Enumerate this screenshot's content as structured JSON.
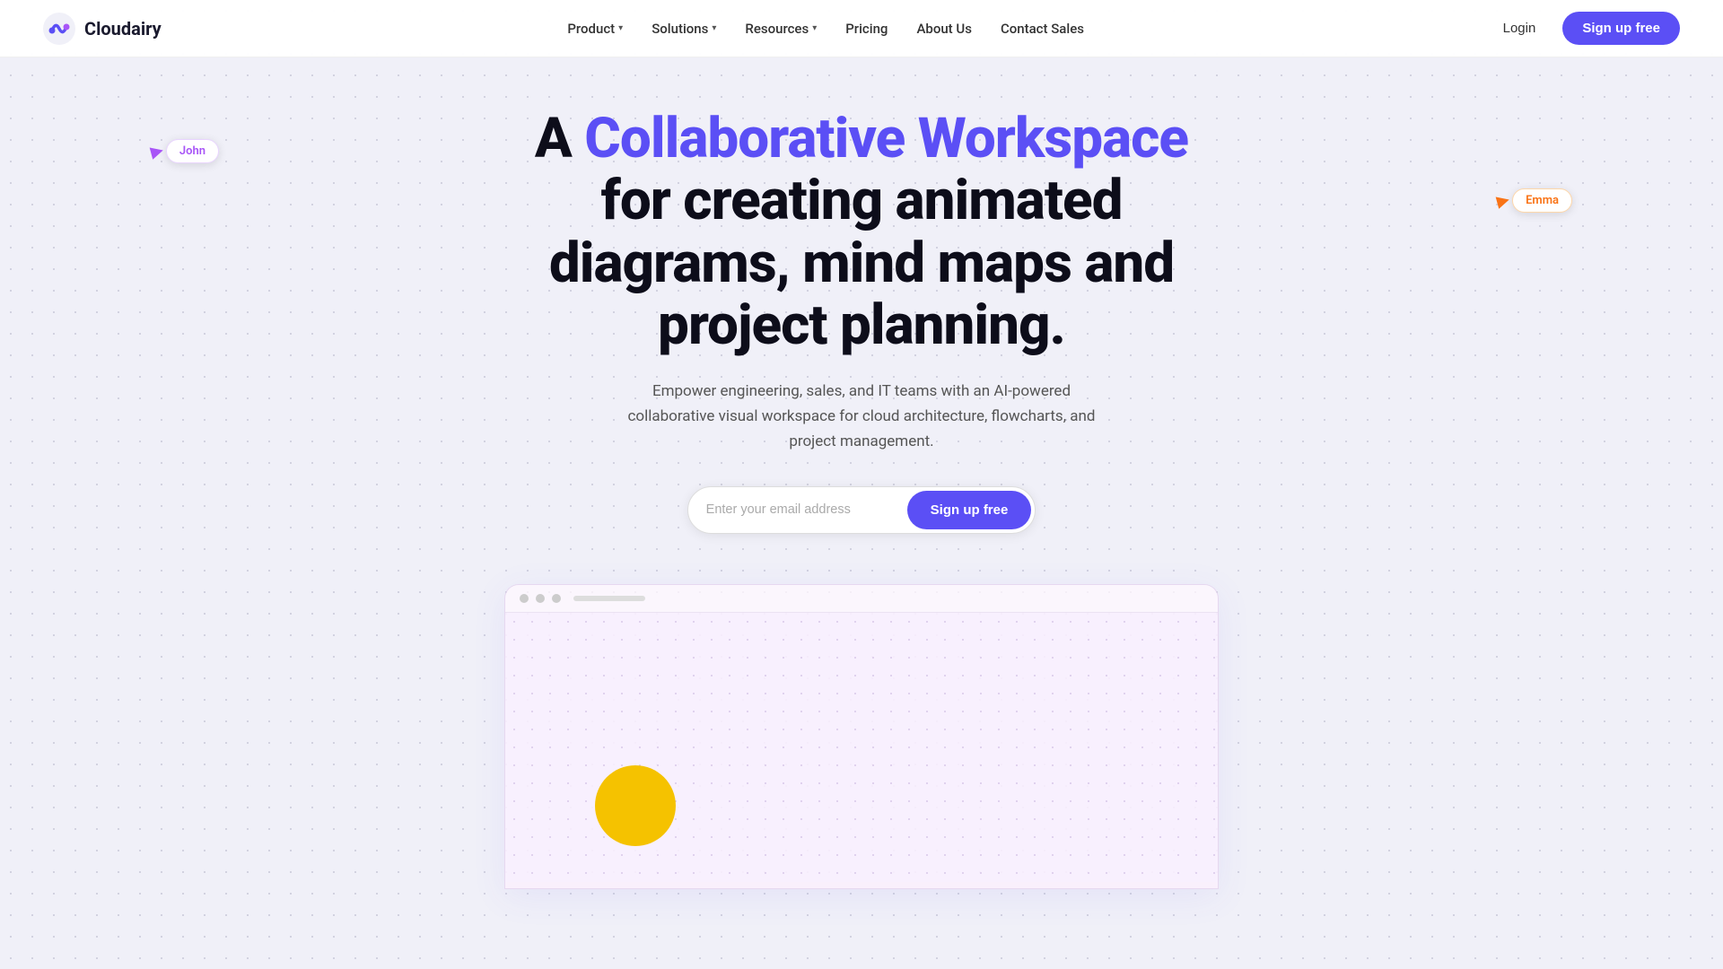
{
  "brand": {
    "name": "Cloudairy",
    "logo_alt": "Cloudairy logo"
  },
  "nav": {
    "links": [
      {
        "label": "Product",
        "has_dropdown": true
      },
      {
        "label": "Solutions",
        "has_dropdown": true
      },
      {
        "label": "Resources",
        "has_dropdown": true
      },
      {
        "label": "Pricing",
        "has_dropdown": false
      },
      {
        "label": "About Us",
        "has_dropdown": false
      },
      {
        "label": "Contact Sales",
        "has_dropdown": false
      }
    ],
    "login_label": "Login",
    "signup_label": "Sign up free"
  },
  "hero": {
    "title_prefix": "A ",
    "title_highlight": "Collaborative Workspace",
    "title_suffix": " for creating animated diagrams, mind maps and project planning.",
    "subtitle": "Empower engineering, sales, and IT teams with an AI-powered collaborative visual workspace for cloud architecture, flowcharts, and project management.",
    "email_placeholder": "Enter your email address",
    "cta_label": "Sign up free"
  },
  "cursors": {
    "john": {
      "label": "John"
    },
    "emma": {
      "label": "Emma"
    }
  },
  "preview": {
    "titlebar_lines": 1
  },
  "colors": {
    "primary": "#5b4ff5",
    "john_cursor": "#a855f7",
    "emma_cursor": "#f97316",
    "circle_fill": "#f5c200"
  }
}
